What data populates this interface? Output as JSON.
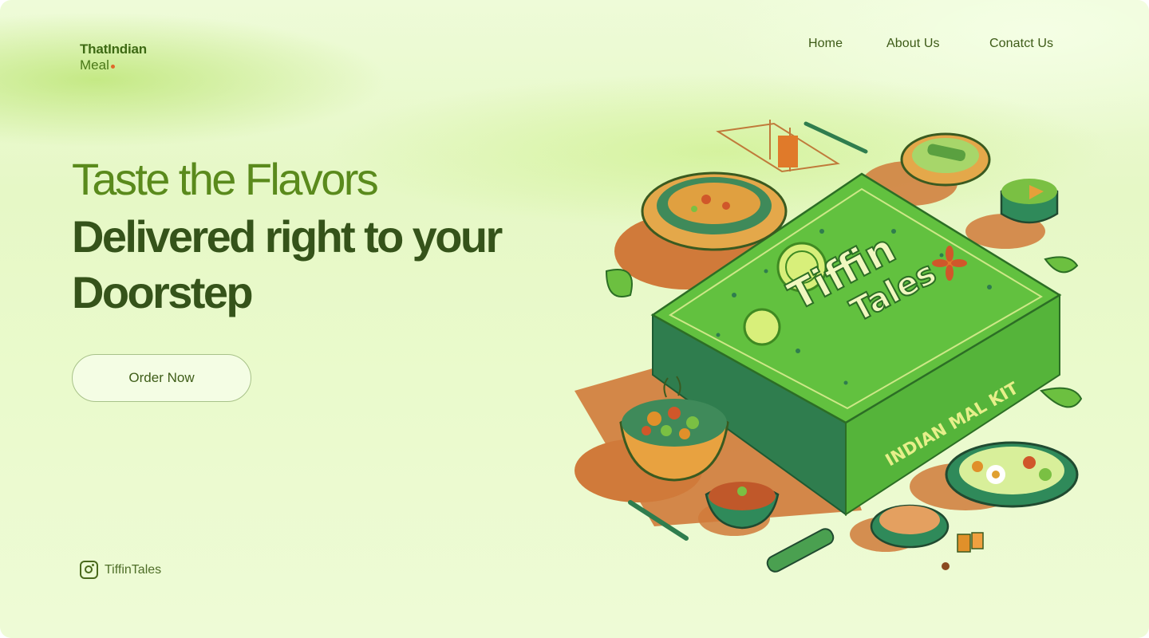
{
  "logo": {
    "line1": "ThatIndian",
    "line2": "Meal"
  },
  "nav": {
    "items": [
      "Home",
      "About Us",
      "Conatct Us"
    ]
  },
  "hero": {
    "line1": "Taste the Flavors",
    "line2": "Delivered right to your Doorstep"
  },
  "cta": {
    "label": "Order Now"
  },
  "social": {
    "handle": "TiffinTales",
    "icon": "instagram-icon"
  },
  "box_art": {
    "brand_top": "Tiffin",
    "brand_bottom": "Tales",
    "side_text": "INDIAN MAL KIT"
  },
  "colors": {
    "accent_dark": "#35531a",
    "accent_light": "#5a8a1c",
    "box_green": "#5cba3a",
    "orange_shadow": "#d07a3a"
  }
}
